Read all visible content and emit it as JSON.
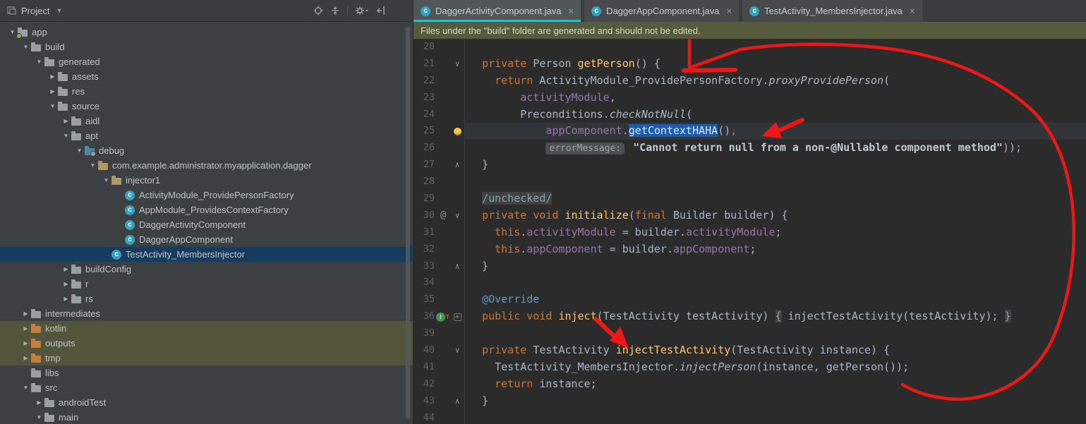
{
  "colors": {
    "accent_teal": "#3ab5c6",
    "selection_blue": "#1d5bab",
    "banner_olive": "#575b3e",
    "annotation_red": "#ef1715",
    "editor_bg": "#2b2b2b",
    "panel_bg": "#3c4042",
    "tree_selected_bg": "#153c5e",
    "tree_excluded_bg": "#52543c"
  },
  "project_panel": {
    "title": "Project",
    "toolbar_icons": [
      "locate-icon",
      "collapse-all-icon",
      "settings-gear-icon",
      "hide-panel-icon"
    ],
    "tree": [
      {
        "label": "app",
        "level": 0,
        "arrow": "expanded",
        "icon": "folder-app"
      },
      {
        "label": "build",
        "level": 1,
        "arrow": "expanded",
        "icon": "folder"
      },
      {
        "label": "generated",
        "level": 2,
        "arrow": "expanded",
        "icon": "folder"
      },
      {
        "label": "assets",
        "level": 3,
        "arrow": "collapsed",
        "icon": "folder"
      },
      {
        "label": "res",
        "level": 3,
        "arrow": "collapsed",
        "icon": "folder"
      },
      {
        "label": "source",
        "level": 3,
        "arrow": "expanded",
        "icon": "folder"
      },
      {
        "label": "aidl",
        "level": 4,
        "arrow": "collapsed",
        "icon": "folder"
      },
      {
        "label": "apt",
        "level": 4,
        "arrow": "expanded",
        "icon": "folder"
      },
      {
        "label": "debug",
        "level": 5,
        "arrow": "expanded",
        "icon": "folder-gen"
      },
      {
        "label": "com.example.administrator.myapplication.dagger",
        "level": 6,
        "arrow": "expanded",
        "icon": "package"
      },
      {
        "label": "injector1",
        "level": 7,
        "arrow": "expanded",
        "icon": "package"
      },
      {
        "label": "ActivityModule_ProvidePersonFactory",
        "level": 8,
        "arrow": "none",
        "icon": "class"
      },
      {
        "label": "AppModule_ProvidesContextFactory",
        "level": 8,
        "arrow": "none",
        "icon": "class"
      },
      {
        "label": "DaggerActivityComponent",
        "level": 8,
        "arrow": "none",
        "icon": "class"
      },
      {
        "label": "DaggerAppComponent",
        "level": 8,
        "arrow": "none",
        "icon": "class"
      },
      {
        "label": "TestActivity_MembersInjector",
        "level": 7,
        "arrow": "none",
        "icon": "class",
        "selected": true
      },
      {
        "label": "buildConfig",
        "level": 4,
        "arrow": "collapsed",
        "icon": "folder"
      },
      {
        "label": "r",
        "level": 4,
        "arrow": "collapsed",
        "icon": "folder"
      },
      {
        "label": "rs",
        "level": 4,
        "arrow": "collapsed",
        "icon": "folder"
      },
      {
        "label": "intermediates",
        "level": 1,
        "arrow": "collapsed",
        "icon": "folder"
      },
      {
        "label": "kotlin",
        "level": 1,
        "arrow": "collapsed",
        "icon": "folder-orange",
        "highlighted": true
      },
      {
        "label": "outputs",
        "level": 1,
        "arrow": "collapsed",
        "icon": "folder-orange",
        "highlighted": true
      },
      {
        "label": "tmp",
        "level": 1,
        "arrow": "collapsed",
        "icon": "folder-orange",
        "highlighted": true
      },
      {
        "label": "libs",
        "level": 1,
        "arrow": "none",
        "icon": "folder"
      },
      {
        "label": "src",
        "level": 1,
        "arrow": "expanded",
        "icon": "folder"
      },
      {
        "label": "androidTest",
        "level": 2,
        "arrow": "collapsed",
        "icon": "folder"
      },
      {
        "label": "main",
        "level": 2,
        "arrow": "expanded",
        "icon": "folder"
      }
    ]
  },
  "editor_tabs": [
    {
      "label": "DaggerActivityComponent.java",
      "active": true
    },
    {
      "label": "DaggerAppComponent.java",
      "active": false
    },
    {
      "label": "TestActivity_MembersInjector.java",
      "active": false
    }
  ],
  "banner": {
    "text": "Files under the \"build\" folder are generated and should not be edited."
  },
  "editor": {
    "lines": [
      {
        "num": "20",
        "g": {},
        "t": []
      },
      {
        "num": "21",
        "g": {
          "fold": "open"
        },
        "t": [
          [
            "  ",
            "pl"
          ],
          [
            "private",
            "kw"
          ],
          [
            " Person ",
            "pl"
          ],
          [
            "getPerson",
            "meth"
          ],
          [
            "() {",
            "pl"
          ]
        ]
      },
      {
        "num": "22",
        "g": {},
        "t": [
          [
            "    ",
            "pl"
          ],
          [
            "return",
            "kw"
          ],
          [
            " ActivityModule_ProvidePersonFactory.",
            "pl"
          ],
          [
            "proxyProvidePerson",
            "itc"
          ],
          [
            "(",
            "pl"
          ]
        ]
      },
      {
        "num": "23",
        "g": {},
        "t": [
          [
            "        ",
            "pl"
          ],
          [
            "activityModule",
            "fld"
          ],
          [
            ",",
            "pl"
          ]
        ]
      },
      {
        "num": "24",
        "g": {},
        "t": [
          [
            "        Preconditions.",
            "pl"
          ],
          [
            "checkNotNull",
            "itc"
          ],
          [
            "(",
            "pl"
          ]
        ]
      },
      {
        "num": "25",
        "g": {
          "bulb": true,
          "current": true
        },
        "t": [
          [
            "            ",
            "pl"
          ],
          [
            "appComponent",
            "fld"
          ],
          [
            ".",
            "pl"
          ],
          [
            "getContextHAHA",
            "sel"
          ],
          [
            "()",
            "pl"
          ],
          [
            ",",
            "kw"
          ]
        ]
      },
      {
        "num": "26",
        "g": {},
        "t": [
          [
            "            ",
            "pl"
          ],
          [
            "errorMessage:",
            "hint"
          ],
          [
            " ",
            "pl"
          ],
          [
            "\"Cannot return null from a non-@Nullable component method\"",
            "str"
          ],
          [
            "));",
            "pl"
          ]
        ]
      },
      {
        "num": "27",
        "g": {
          "fold": "close"
        },
        "t": [
          [
            "  }",
            "pl"
          ]
        ]
      },
      {
        "num": "28",
        "g": {},
        "t": []
      },
      {
        "num": "29",
        "g": {},
        "t": [
          [
            "  ",
            "pl"
          ],
          [
            "/unchecked/",
            "fold"
          ]
        ]
      },
      {
        "num": "30",
        "g": {
          "at": true,
          "fold": "open"
        },
        "t": [
          [
            "  ",
            "pl"
          ],
          [
            "private",
            "kw"
          ],
          [
            " ",
            "pl"
          ],
          [
            "void",
            "kw"
          ],
          [
            " ",
            "pl"
          ],
          [
            "initialize",
            "meth"
          ],
          [
            "(",
            "pl"
          ],
          [
            "final",
            "kw"
          ],
          [
            " Builder builder) {",
            "pl"
          ]
        ]
      },
      {
        "num": "31",
        "g": {},
        "t": [
          [
            "    ",
            "pl"
          ],
          [
            "this",
            "kw"
          ],
          [
            ".",
            "pl"
          ],
          [
            "activityModule",
            "fld"
          ],
          [
            " = builder.",
            "pl"
          ],
          [
            "activityModule",
            "fld"
          ],
          [
            ";",
            "pl"
          ]
        ]
      },
      {
        "num": "32",
        "g": {},
        "t": [
          [
            "    ",
            "pl"
          ],
          [
            "this",
            "kw"
          ],
          [
            ".",
            "pl"
          ],
          [
            "appComponent",
            "fld"
          ],
          [
            " = builder.",
            "pl"
          ],
          [
            "appComponent",
            "fld"
          ],
          [
            ";",
            "pl"
          ]
        ]
      },
      {
        "num": "33",
        "g": {
          "fold": "close"
        },
        "t": [
          [
            "  }",
            "pl"
          ]
        ]
      },
      {
        "num": "34",
        "g": {},
        "t": []
      },
      {
        "num": "35",
        "g": {},
        "t": [
          [
            "  ",
            "pl"
          ],
          [
            "@Override",
            "ann"
          ]
        ]
      },
      {
        "num": "36",
        "g": {
          "override": true,
          "foldbox": true
        },
        "t": [
          [
            "  ",
            "pl"
          ],
          [
            "public",
            "kw"
          ],
          [
            " ",
            "pl"
          ],
          [
            "void",
            "kw"
          ],
          [
            " ",
            "pl"
          ],
          [
            "inject",
            "meth"
          ],
          [
            "(TestActivity testActivity) ",
            "pl"
          ],
          [
            "{",
            "fold"
          ],
          [
            " injectTestActivity(testActivity); ",
            "pl"
          ],
          [
            "}",
            "fold"
          ]
        ]
      },
      {
        "num": "39",
        "g": {},
        "t": []
      },
      {
        "num": "40",
        "g": {
          "fold": "open"
        },
        "t": [
          [
            "  ",
            "pl"
          ],
          [
            "private",
            "kw"
          ],
          [
            " TestActivity ",
            "pl"
          ],
          [
            "injectTestActivity",
            "meth"
          ],
          [
            "(TestActivity instance) {",
            "pl"
          ]
        ]
      },
      {
        "num": "41",
        "g": {},
        "t": [
          [
            "    TestActivity_MembersInjector.",
            "pl"
          ],
          [
            "injectPerson",
            "itc"
          ],
          [
            "(instance, getPerson());",
            "pl"
          ]
        ]
      },
      {
        "num": "42",
        "g": {},
        "t": [
          [
            "    ",
            "pl"
          ],
          [
            "return",
            "kw"
          ],
          [
            " instance;",
            "pl"
          ]
        ]
      },
      {
        "num": "43",
        "g": {
          "fold": "close"
        },
        "t": [
          [
            "  }",
            "pl"
          ]
        ]
      },
      {
        "num": "44",
        "g": {},
        "t": []
      }
    ]
  }
}
